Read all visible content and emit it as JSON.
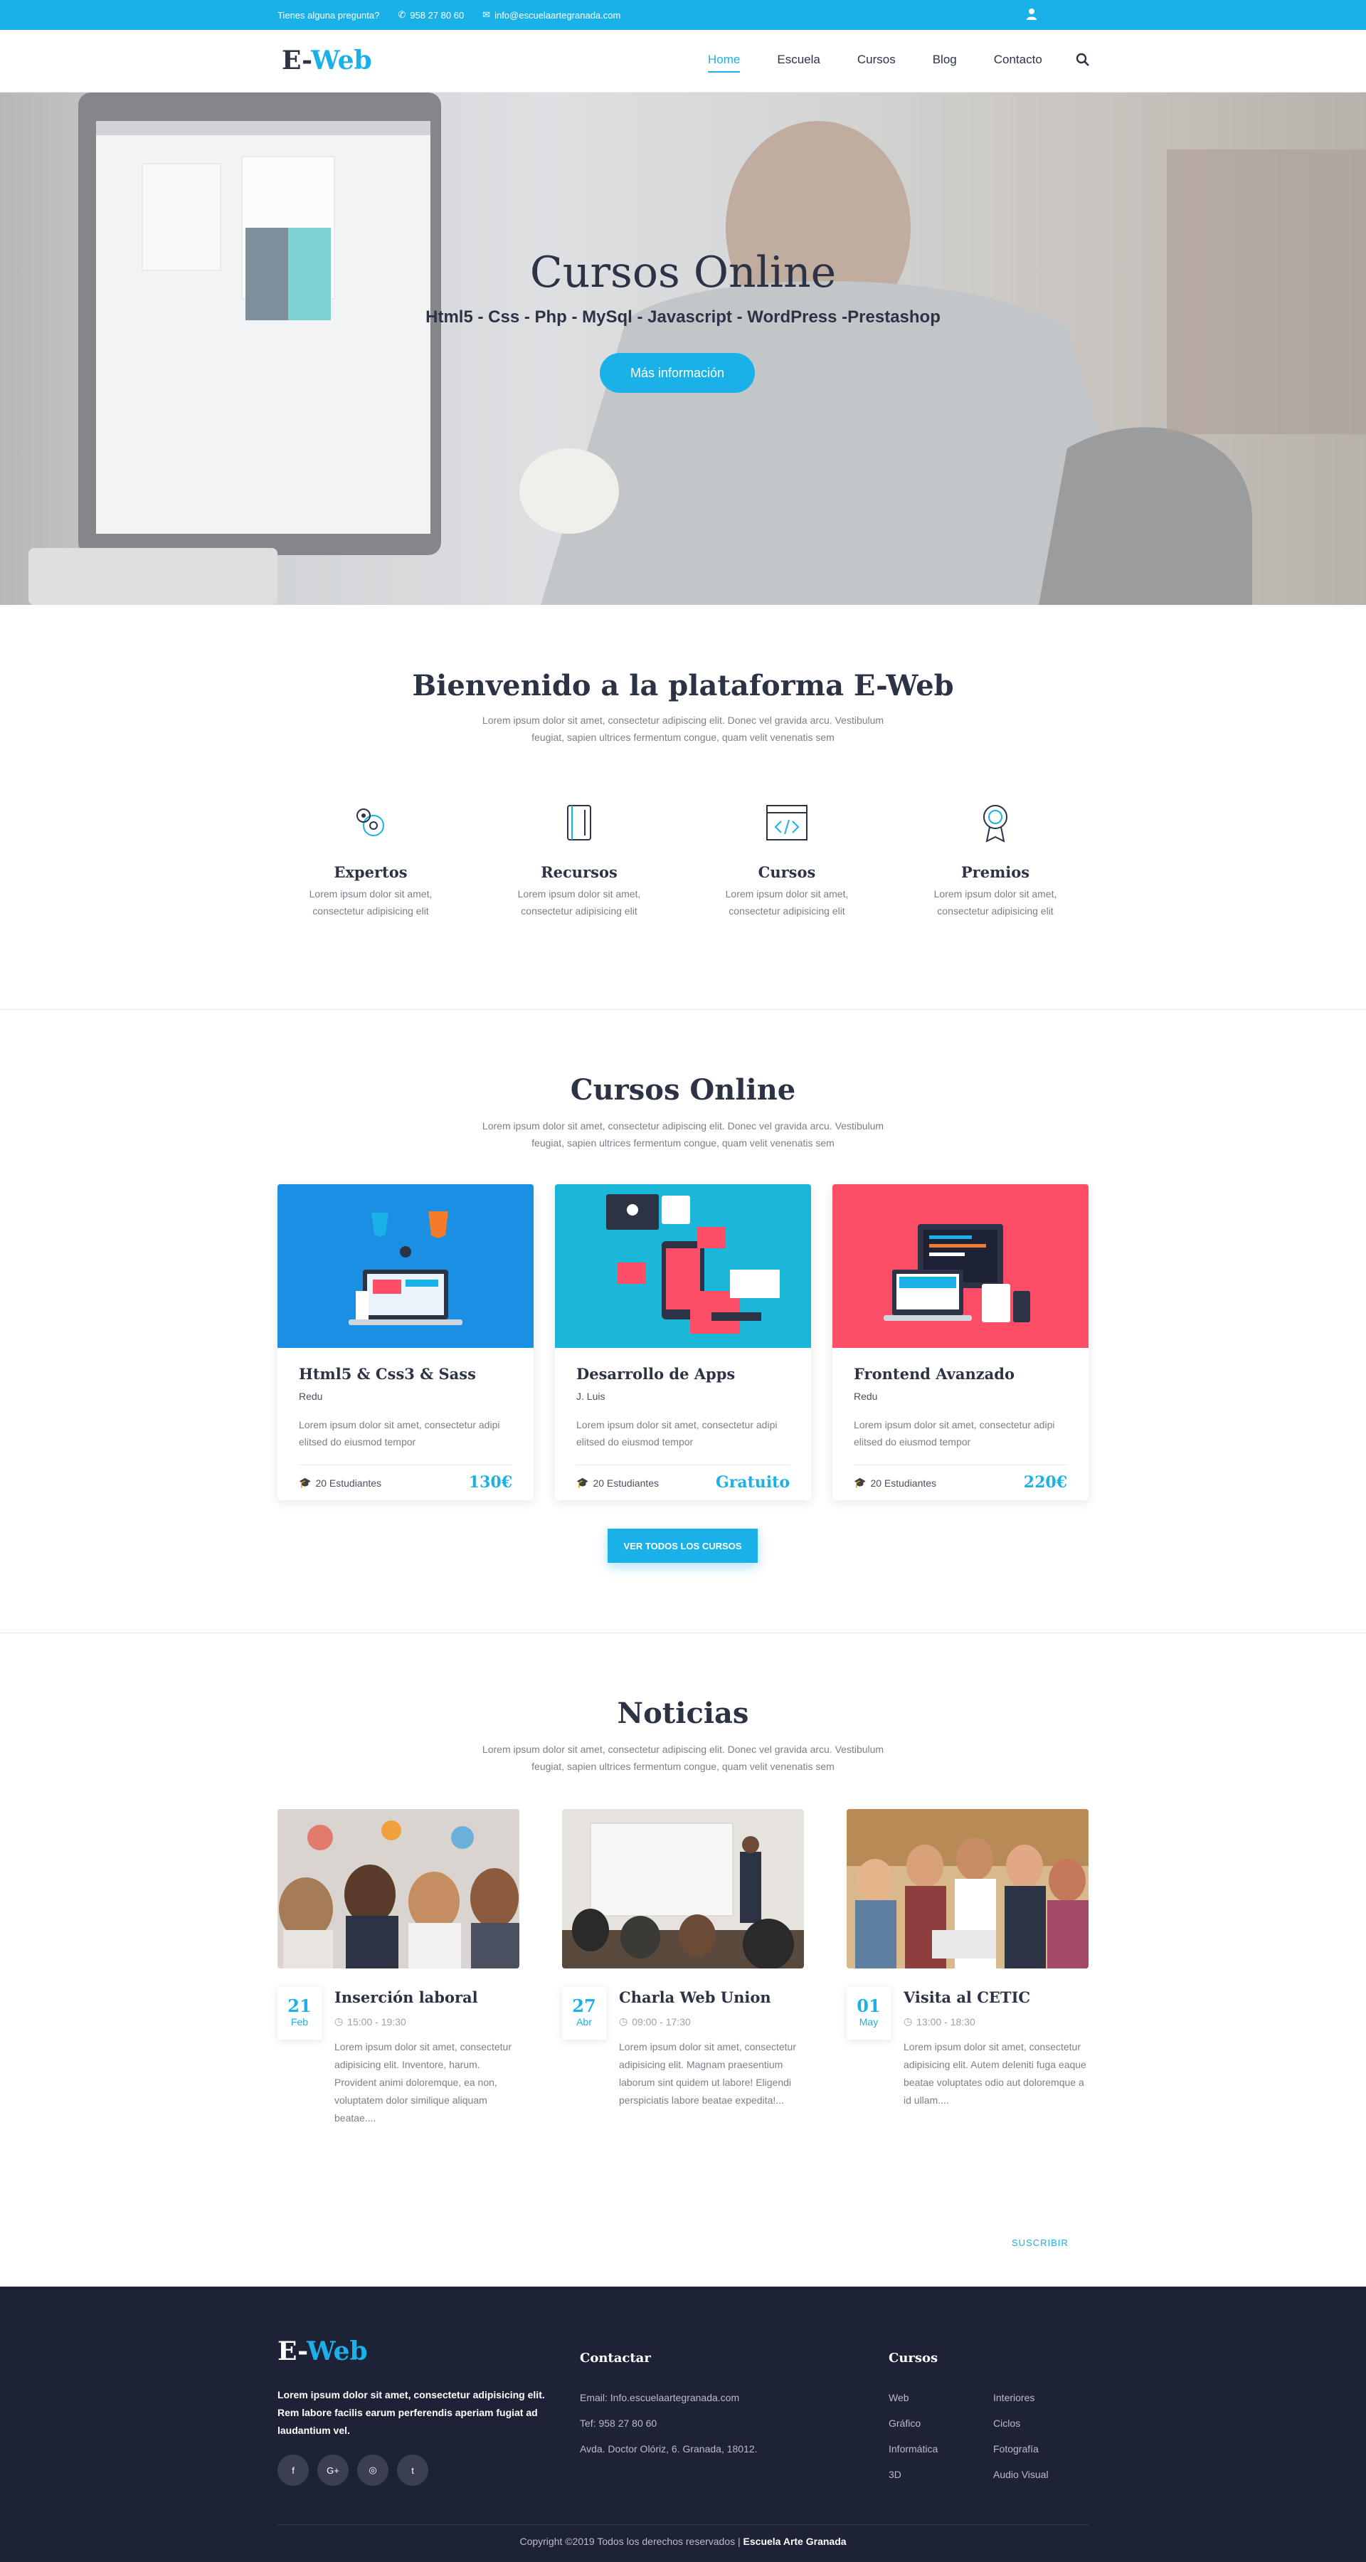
{
  "topbar": {
    "question": "Tienes alguna pregunta?",
    "phone": "958 27 80 60",
    "email": "info@escuelaartegranada.com"
  },
  "nav": {
    "logo_main": "E-",
    "logo_accent": "Web",
    "items": [
      "Home",
      "Escuela",
      "Cursos",
      "Blog",
      "Contacto"
    ],
    "active": "Home"
  },
  "hero": {
    "title": "Cursos Online",
    "subtitle": "Html5 - Css - Php - MySql - Javascript - WordPress -Prestashop",
    "button": "Más información"
  },
  "welcome": {
    "title": "Bienvenido a la plataforma E-Web",
    "desc": "Lorem ipsum dolor sit amet, consectetur adipiscing elit. Donec vel gravida arcu. Vestibulum feugiat, sapien ultrices fermentum congue, quam velit venenatis sem",
    "features": [
      {
        "title": "Expertos",
        "desc": "Lorem ipsum dolor sit amet, consectetur adipisicing elit",
        "icon": "gears-icon"
      },
      {
        "title": "Recursos",
        "desc": "Lorem ipsum dolor sit amet, consectetur adipisicing elit",
        "icon": "book-icon"
      },
      {
        "title": "Cursos",
        "desc": "Lorem ipsum dolor sit amet, consectetur adipisicing elit",
        "icon": "code-window-icon"
      },
      {
        "title": "Premios",
        "desc": "Lorem ipsum dolor sit amet, consectetur adipisicing elit",
        "icon": "award-icon"
      }
    ]
  },
  "courses": {
    "title": "Cursos Online",
    "desc": "Lorem ipsum dolor sit amet, consectetur adipiscing elit. Donec vel gravida arcu. Vestibulum feugiat, sapien ultrices fermentum congue, quam velit venenatis sem",
    "items": [
      {
        "title": "Html5 & Css3 & Sass",
        "author": "Redu",
        "desc": "Lorem ipsum dolor sit amet, consectetur adipi elitsed do eiusmod tempor",
        "students": "20 Estudiantes",
        "price": "130€",
        "color": "#1a8fe3"
      },
      {
        "title": "Desarrollo de Apps",
        "author": "J. Luis",
        "desc": "Lorem ipsum dolor sit amet, consectetur adipi elitsed do eiusmod tempor",
        "students": "20 Estudiantes",
        "price": "Gratuito",
        "color": "#1ab7d8"
      },
      {
        "title": "Frontend Avanzado",
        "author": "Redu",
        "desc": "Lorem ipsum dolor sit amet, consectetur adipi elitsed do eiusmod tempor",
        "students": "20 Estudiantes",
        "price": "220€",
        "color": "#fd4e68"
      }
    ],
    "button": "VER TODOS LOS CURSOS"
  },
  "news": {
    "title": "Noticias",
    "desc": "Lorem ipsum dolor sit amet, consectetur adipiscing elit. Donec vel gravida arcu. Vestibulum feugiat, sapien ultrices fermentum congue, quam velit venenatis sem",
    "items": [
      {
        "day": "21",
        "month": "Feb",
        "title": "Inserción laboral",
        "time": "15:00 - 19:30",
        "desc": "Lorem ipsum dolor sit amet, consectetur adipisicing elit. Inventore, harum. Provident animi doloremque, ea non, voluptatem dolor similique aliquam beatae...."
      },
      {
        "day": "27",
        "month": "Abr",
        "title": "Charla Web Union",
        "time": "09:00 - 17:30",
        "desc": "Lorem ipsum dolor sit amet, consectetur adipisicing elit. Magnam praesentium laborum sint quidem ut labore! Eligendi perspiciatis labore beatae expedita!..."
      },
      {
        "day": "01",
        "month": "May",
        "title": "Visita al CETIC",
        "time": "13:00 - 18:30",
        "desc": "Lorem ipsum dolor sit amet, consectetur adipisicing elit.  Autem deleniti fuga eaque beatae voluptates odio aut doloremque a id ullam...."
      }
    ],
    "subscribe": "SUSCRIBIR"
  },
  "footer": {
    "logo_main": "E-",
    "logo_accent": "Web",
    "about": "Lorem ipsum dolor sit amet, consectetur adipisicing elit. Rem labore facilis earum perferendis aperiam fugiat ad laudantium vel.",
    "socials": [
      "f",
      "G+",
      "◎",
      "t"
    ],
    "contact_title": "Contactar",
    "contact": [
      "Email: Info.escuelaartegranada.com",
      "Tef: 958 27 80 60",
      "Avda. Doctor Olóriz, 6. Granada, 18012."
    ],
    "courses_title": "Cursos",
    "links_col1": [
      "Web",
      "Gráfico",
      "Informática",
      "3D"
    ],
    "links_col2": [
      "Interiores",
      "Ciclos",
      "Fotografía",
      "Audio Visual"
    ],
    "copyright": "Copyright ©2019 Todos los derechos reservados | ",
    "copyright_brand": "Escuela Arte Granada"
  }
}
